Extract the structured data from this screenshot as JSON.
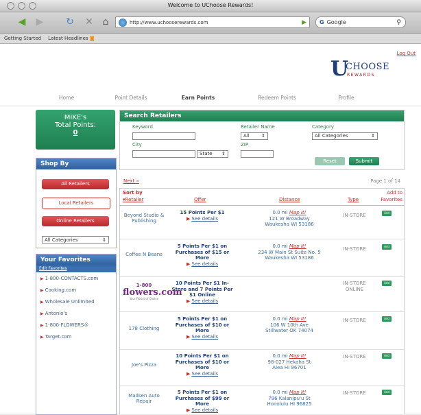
{
  "window": {
    "title": "Welcome to UChoose Rewards!"
  },
  "browser": {
    "url": "http://www.uchooserewards.com",
    "search_engine": "Google",
    "bookmarks": [
      "Getting Started",
      "Latest Headlines"
    ]
  },
  "header": {
    "logout": "Log Out",
    "logo": {
      "u": "U",
      "choose": "CHOOSE",
      "rewards": "REWARDS"
    }
  },
  "nav": [
    "Home",
    "Point Details",
    "Earn Points",
    "Redeem Points",
    "Profile"
  ],
  "nav_active": "Earn Points",
  "points": {
    "line1": "MIKE's",
    "line2": "Total Points:",
    "value": "0"
  },
  "shop_by": {
    "title": "Shop By",
    "buttons": [
      "All Retailers",
      "Local Retailers",
      "Online Retailers"
    ],
    "category": "All Categories"
  },
  "favorites": {
    "title": "Your Favorites",
    "edit": "Edit Favorites",
    "items": [
      "1-800-CONTACTS.com",
      "Cooking.com",
      "Wholesale Unlimited",
      "Antonio's",
      "1-800-FLOWERS®",
      "Target.com"
    ]
  },
  "search": {
    "title": "Search Retailers",
    "keyword_label": "Keyword",
    "retailer_name_label": "Retailer Name",
    "retailer_name_value": "All",
    "category_label": "Category",
    "category_value": "All Categories",
    "city_label": "City",
    "state_value": "State",
    "zip_label": "ZIP",
    "reset": "Reset",
    "submit": "Submit"
  },
  "pager": {
    "next": "Next »",
    "page": "Page 1 of 14"
  },
  "results": {
    "headers": {
      "sort_by": "Sort by",
      "retailer": "Retailer",
      "offer": "Offer",
      "distance": "Distance",
      "type": "Type",
      "add_to": "Add to",
      "favorites": "Favorites"
    },
    "see_details": "See details",
    "map_it": "Map It!",
    "add": "Add",
    "rows": [
      {
        "name": "Beyond Studio & Publishing",
        "offer": "15 Points Per $1",
        "miles": "0.0 mi",
        "address1": "121 W Broadway",
        "address2": "Waukesha WI 53186",
        "type": "IN-STORE"
      },
      {
        "name": "Coffee N Beans",
        "offer": "5 Points Per $1 on Purchases of $15 or More",
        "miles": "0.0 mi",
        "address1": "234 W Main St Suite No. 5",
        "address2": "Waukesha WI 53186",
        "type": "IN-STORE"
      },
      {
        "name": "1-800-flowers.com",
        "logo": {
          "a": "1-800",
          "b": "flowers.com",
          "c": "Your Florist of Choice"
        },
        "offer": "10 Points Per $1 In-Store and 7 Points Per $1 Online",
        "miles": "",
        "address1": "",
        "address2": "",
        "type": "IN-STORE ONLINE"
      },
      {
        "name": "178 Clothing",
        "offer": "5 Points Per $1 on Purchases of $10 or More",
        "miles": "0.0 mi",
        "address1": "106 W 10th Ave",
        "address2": "Stillwater OK 74074",
        "type": "IN-STORE"
      },
      {
        "name": "Joe's Pizza",
        "offer": "10 Points Per $1 on Purchases of $10 or More",
        "miles": "0.0 mi",
        "address1": "98-027 Hekaha St",
        "address2": "Aiea HI 96701",
        "type": "IN-STORE"
      },
      {
        "name": "Madsen Auto Repair",
        "offer": "5 Points Per $1 on Purchases of $99 or More",
        "miles": "0.0 mi",
        "address1": "796 Kalanipu'u St",
        "address2": "Honolulu HI 96825",
        "type": "IN-STORE"
      }
    ]
  }
}
